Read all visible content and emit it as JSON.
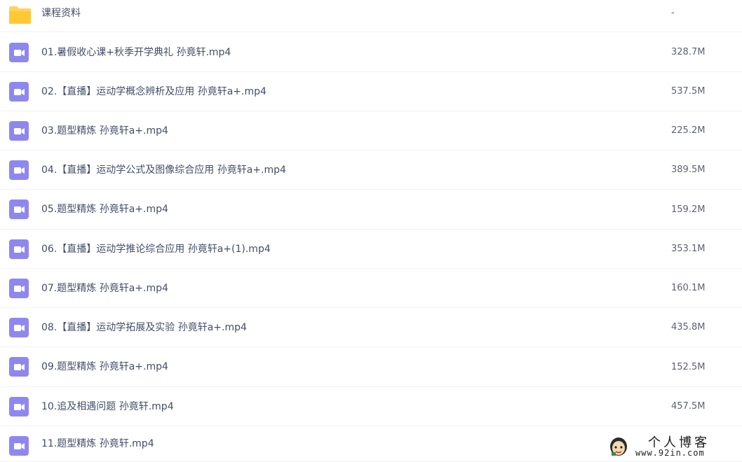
{
  "colors": {
    "video_icon": "#8f87f0",
    "folder_icon": "#ffd35a",
    "row_divider": "#f1f2f4",
    "name_text": "#424e67",
    "size_text": "#5c6270"
  },
  "files": [
    {
      "name": "课程资料",
      "size": "-",
      "icon": "folder-icon"
    },
    {
      "name": "01.暑假收心课+秋季开学典礼 孙竟轩.mp4",
      "size": "328.7M",
      "icon": "video-file-icon"
    },
    {
      "name": "02.【直播】运动学概念辨析及应用 孙竟轩a+.mp4",
      "size": "537.5M",
      "icon": "video-file-icon"
    },
    {
      "name": "03.题型精炼 孙竟轩a+.mp4",
      "size": "225.2M",
      "icon": "video-file-icon"
    },
    {
      "name": "04.【直播】运动学公式及图像综合应用 孙竟轩a+.mp4",
      "size": "389.5M",
      "icon": "video-file-icon"
    },
    {
      "name": "05.题型精炼 孙竟轩a+.mp4",
      "size": "159.2M",
      "icon": "video-file-icon"
    },
    {
      "name": "06.【直播】运动学推论综合应用 孙竟轩a+(1).mp4",
      "size": "353.1M",
      "icon": "video-file-icon"
    },
    {
      "name": "07.题型精炼 孙竟轩a+.mp4",
      "size": "160.1M",
      "icon": "video-file-icon"
    },
    {
      "name": "08.【直播】运动学拓展及实验 孙竟轩a+.mp4",
      "size": "435.8M",
      "icon": "video-file-icon"
    },
    {
      "name": "09.题型精炼 孙竟轩a+.mp4",
      "size": "152.5M",
      "icon": "video-file-icon"
    },
    {
      "name": "10.追及相遇问题 孙竟轩.mp4",
      "size": "457.5M",
      "icon": "video-file-icon"
    },
    {
      "name": "11.题型精炼 孙竟轩.mp4",
      "size": "",
      "icon": "video-file-icon"
    }
  ],
  "watermark": {
    "title": "个人博客",
    "url": "www.92in.com"
  }
}
